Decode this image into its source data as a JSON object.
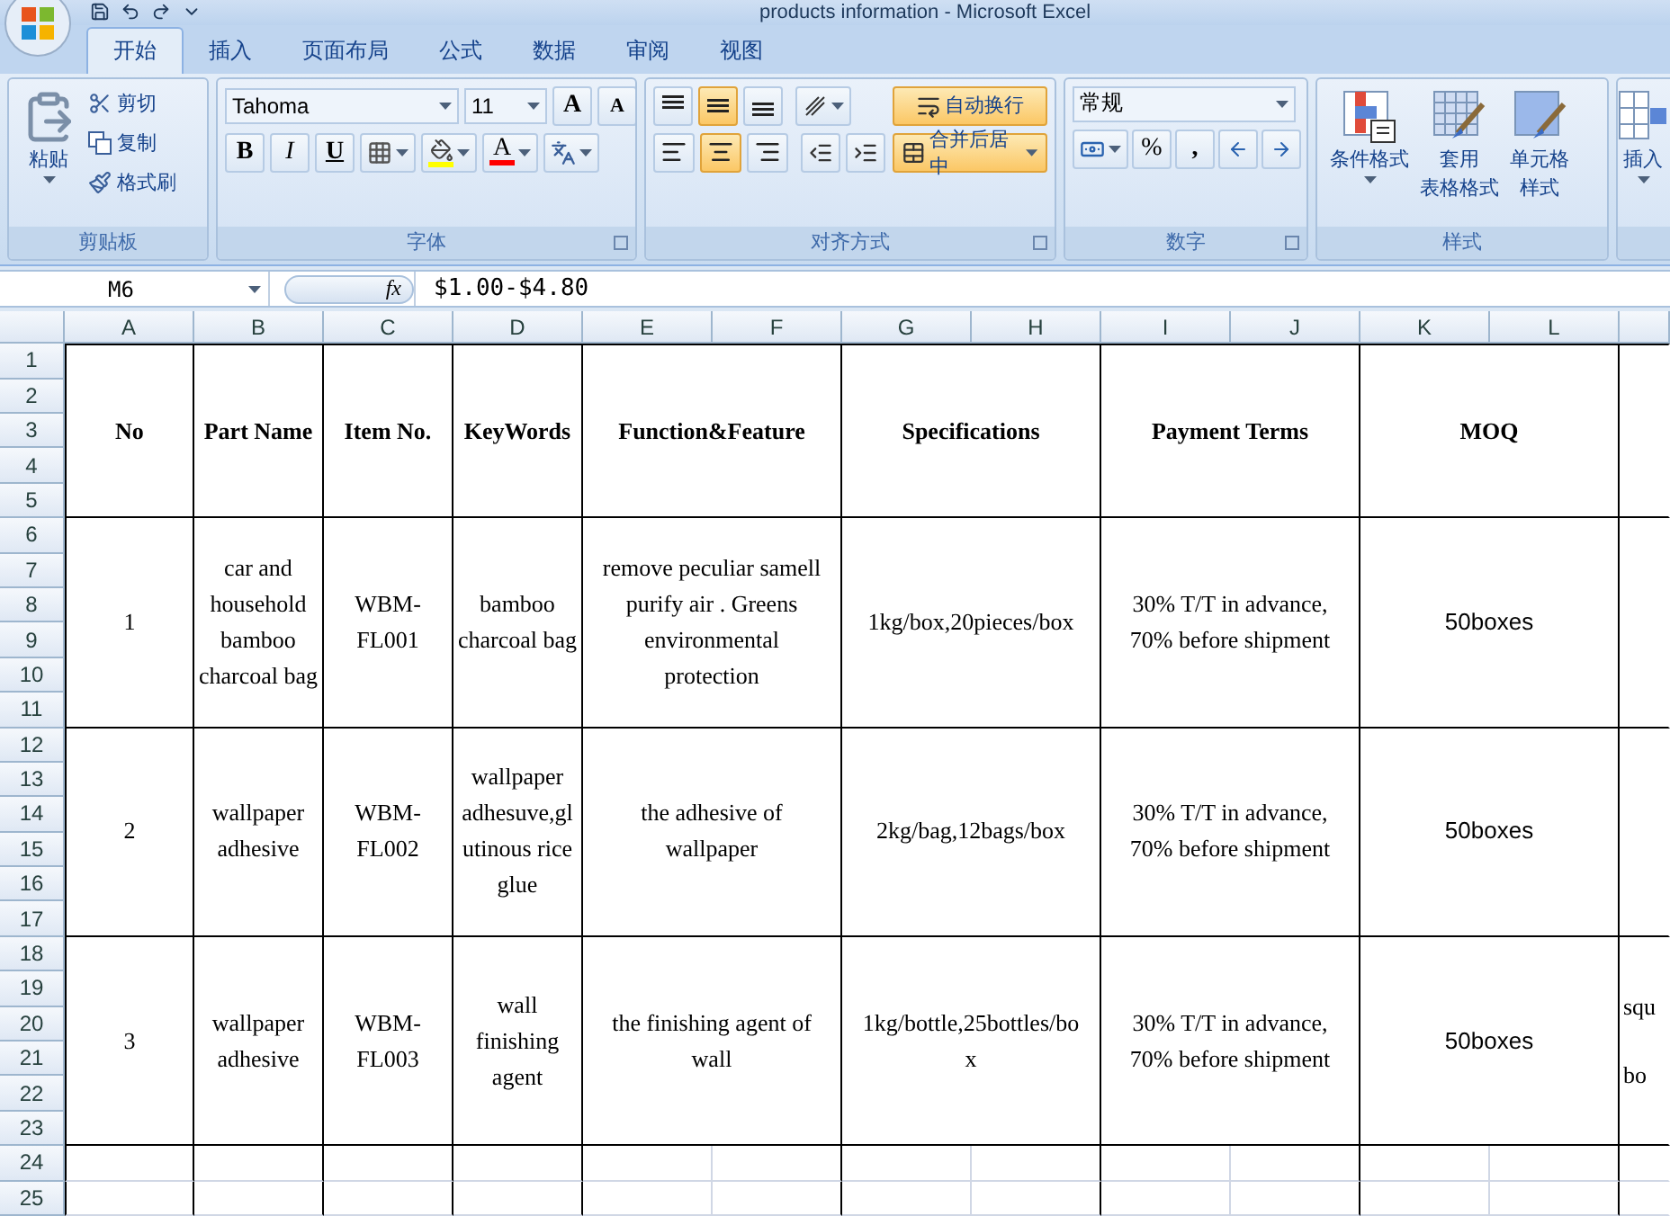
{
  "window": {
    "title": "products information - Microsoft Excel"
  },
  "tabs": [
    {
      "label": "开始",
      "selected": true
    },
    {
      "label": "插入",
      "selected": false
    },
    {
      "label": "页面布局",
      "selected": false
    },
    {
      "label": "公式",
      "selected": false
    },
    {
      "label": "数据",
      "selected": false
    },
    {
      "label": "审阅",
      "selected": false
    },
    {
      "label": "视图",
      "selected": false
    }
  ],
  "ribbon": {
    "clipboard": {
      "label": "剪贴板",
      "paste": "粘贴",
      "items": [
        "剪切",
        "复制",
        "格式刷"
      ]
    },
    "font": {
      "label": "字体",
      "font_name": "Tahoma",
      "font_size": "11",
      "grow": "A",
      "shrink": "A",
      "bold": "B",
      "italic": "I",
      "underline": "U",
      "font_color": "A"
    },
    "alignment": {
      "label": "对齐方式",
      "vertical": [
        {
          "kind": "top",
          "selected": false
        },
        {
          "kind": "middle",
          "selected": true
        },
        {
          "kind": "bottom",
          "selected": false
        }
      ],
      "horizontal": [
        {
          "kind": "left",
          "selected": false
        },
        {
          "kind": "center",
          "selected": true
        },
        {
          "kind": "right",
          "selected": false
        }
      ],
      "wrap_text": {
        "label": "自动换行",
        "selected": true
      },
      "merge_center": {
        "label": "合并后居中",
        "selected": true
      }
    },
    "number": {
      "label": "数字",
      "format": "常规",
      "percent": "%",
      "comma": ","
    },
    "styles": {
      "label": "样式",
      "buttons": [
        {
          "kind": "conditional",
          "lines": [
            "条件格式"
          ]
        },
        {
          "kind": "table",
          "lines": [
            "套用",
            "表格格式"
          ]
        },
        {
          "kind": "cell",
          "lines": [
            "单元格",
            "样式"
          ]
        }
      ]
    },
    "cells": {
      "buttons": [
        "插入"
      ]
    }
  },
  "formula_bar": {
    "name_box": "M6",
    "fx": "fx",
    "formula": "$1.00-$4.80"
  },
  "sheet": {
    "columns": [
      "A",
      "B",
      "C",
      "D",
      "E",
      "F",
      "G",
      "H",
      "I",
      "J",
      "K",
      "L"
    ],
    "rows": [
      "1",
      "2",
      "3",
      "4",
      "5",
      "6",
      "7",
      "8",
      "9",
      "10",
      "11",
      "12",
      "13",
      "14",
      "15",
      "16",
      "17",
      "18",
      "19",
      "20",
      "21",
      "22",
      "23",
      "24",
      "25"
    ],
    "header": [
      "No",
      "Part Name",
      "Item No.",
      "KeyWords",
      "Function&Feature",
      "Specifications",
      "Payment Terms",
      "MOQ"
    ],
    "records": [
      {
        "no": "1",
        "part_name": "car and household bamboo charcoal bag",
        "item_no": "WBM-FL001",
        "keywords": "bamboo charcoal bag",
        "function": "remove peculiar samell purify air . Greens environmental protection",
        "specifications": "1kg/box,20pieces/box",
        "payment_terms": "30% T/T in advance, 70% before shipment",
        "moq": "50boxes"
      },
      {
        "no": "2",
        "part_name": "wallpaper adhesive",
        "item_no": "WBM-FL002",
        "keywords": "wallpaper adhesuve,glutinous rice glue",
        "function": "the adhesive of wallpaper",
        "specifications": "2kg/bag,12bags/box",
        "payment_terms": "30% T/T in advance, 70% before shipment",
        "moq": "50boxes"
      },
      {
        "no": "3",
        "part_name": "wallpaper adhesive",
        "item_no": "WBM-FL003",
        "keywords": "wall finishing agent",
        "function": "the finishing agent of wall",
        "specifications": "1kg/bottle,25bottles/box",
        "payment_terms": "30% T/T in advance, 70% before shipment",
        "moq": "50boxes",
        "column_m": [
          "squ",
          "bo"
        ]
      }
    ]
  }
}
